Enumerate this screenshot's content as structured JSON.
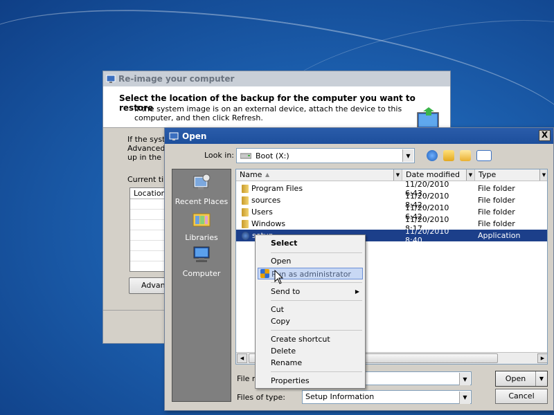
{
  "reimage": {
    "title": "Re-image your computer",
    "heading": "Select the location of the backup for the computer you want to restore",
    "subtext": "If the system image is on an external device, attach the device to this computer, and then click Refresh.",
    "body_line1": "If the syste",
    "body_line2": "Advanced",
    "body_line3": "up in the lis",
    "current_time_label": "Current tim",
    "location_col": "Location",
    "advanced_button": "Advanc"
  },
  "open_dialog": {
    "title": "Open",
    "close_label": "X",
    "look_in_label": "Look in:",
    "look_in_value": "Boot (X:)",
    "places": [
      {
        "label": "Recent Places",
        "icon": "recent-places-icon"
      },
      {
        "label": "Libraries",
        "icon": "libraries-icon"
      },
      {
        "label": "Computer",
        "icon": "computer-icon"
      }
    ],
    "columns": [
      "Name",
      "Date modified",
      "Type"
    ],
    "files": [
      {
        "name": "Program Files",
        "date": "11/20/2010 6:43...",
        "type": "File folder",
        "icon": "folder-icon"
      },
      {
        "name": "sources",
        "date": "11/20/2010 8:42...",
        "type": "File folder",
        "icon": "folder-icon"
      },
      {
        "name": "Users",
        "date": "11/20/2010 6:42...",
        "type": "File folder",
        "icon": "folder-icon"
      },
      {
        "name": "Windows",
        "date": "11/20/2010 8:17...",
        "type": "File folder",
        "icon": "folder-icon"
      },
      {
        "name": "setup",
        "date": "11/20/2010 8:40...",
        "type": "Application",
        "icon": "application-icon"
      }
    ],
    "selected_file_index": 4,
    "file_name_label": "File na",
    "file_name_value": "",
    "files_of_type_label": "Files of type:",
    "files_of_type_value": "Setup Information",
    "open_button": "Open",
    "cancel_button": "Cancel"
  },
  "context_menu": {
    "items": [
      {
        "label": "Select",
        "bold": true
      },
      {
        "label": "Open"
      },
      {
        "label": "Run as administrator",
        "highlighted": true,
        "icon": "uac-shield-icon"
      },
      {
        "label": "Send to",
        "submenu": true
      },
      {
        "label": "Cut"
      },
      {
        "label": "Copy"
      },
      {
        "label": "Create shortcut"
      },
      {
        "label": "Delete"
      },
      {
        "label": "Rename"
      },
      {
        "label": "Properties"
      }
    ]
  },
  "colors": {
    "desktop": "#1c5fae",
    "selection": "#1c3f8a",
    "menu_highlight": "#c8d8f4"
  }
}
